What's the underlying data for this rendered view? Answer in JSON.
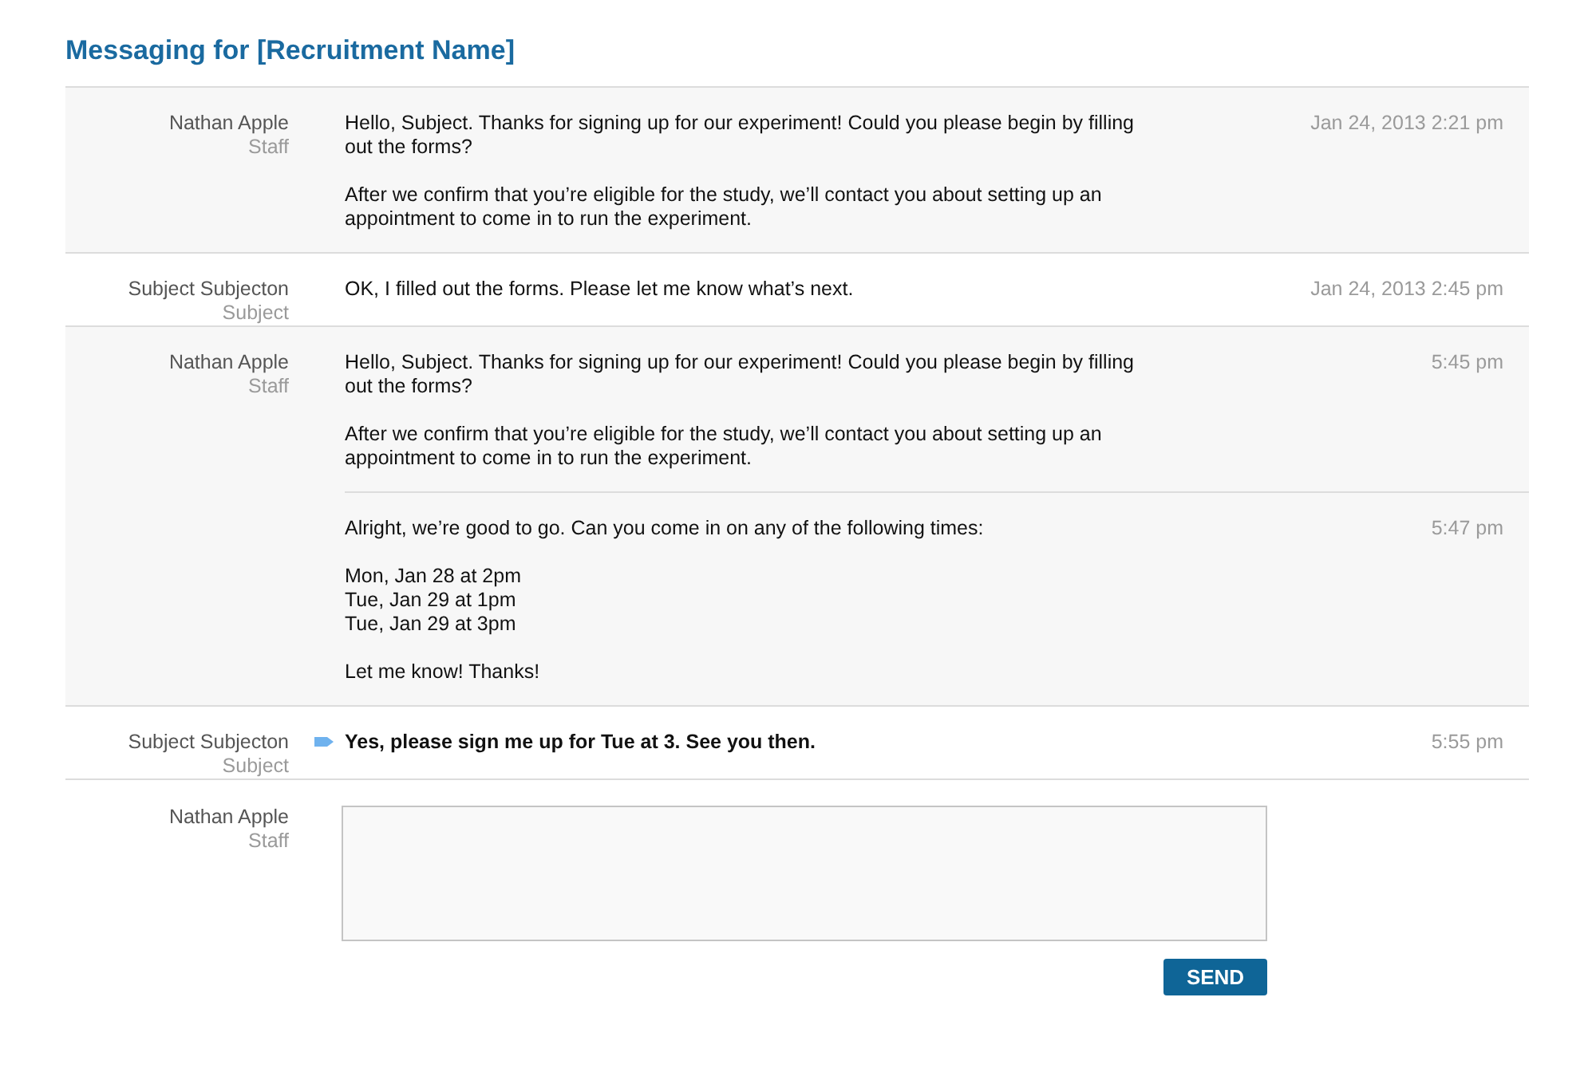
{
  "title": "Messaging for [Recruitment Name]",
  "threads": [
    {
      "kind": "staff",
      "sender": "Nathan Apple",
      "role": "Staff",
      "messages": [
        {
          "unread": false,
          "time": "Jan 24, 2013 2:21 pm",
          "paragraphs": [
            "Hello, Subject. Thanks for signing up for our experiment! Could you please begin by filling out the forms?",
            "After we confirm that you’re eligible for the study, we’ll contact you about setting up an appointment to come in to run the experiment."
          ]
        }
      ]
    },
    {
      "kind": "subject",
      "sender": "Subject Subjecton",
      "role": "Subject",
      "messages": [
        {
          "unread": false,
          "time": "Jan 24, 2013 2:45 pm",
          "paragraphs": [
            "OK, I filled out the forms. Please let me know what’s next."
          ]
        }
      ]
    },
    {
      "kind": "staff",
      "sender": "Nathan Apple",
      "role": "Staff",
      "messages": [
        {
          "unread": false,
          "time": "5:45 pm",
          "paragraphs": [
            "Hello, Subject. Thanks for signing up for our experiment! Could you please begin by filling out the forms?",
            "After we confirm that you’re eligible for the study, we’ll contact you about setting up an appointment to come in to run the experiment."
          ]
        },
        {
          "unread": false,
          "time": "5:47 pm",
          "paragraphs": [
            "Alright, we’re good to go. Can you come in on any of the following times:",
            "Mon, Jan 28 at 2pm\nTue, Jan 29 at 1pm\nTue, Jan 29 at 3pm",
            "Let me know! Thanks!"
          ]
        }
      ]
    },
    {
      "kind": "subject",
      "sender": "Subject Subjecton",
      "role": "Subject",
      "messages": [
        {
          "unread": true,
          "time": "5:55 pm",
          "paragraphs": [
            "Yes, please sign me up for Tue at 3. See you then."
          ]
        }
      ]
    }
  ],
  "compose": {
    "sender": "Nathan Apple",
    "role": "Staff",
    "button": "SEND"
  }
}
